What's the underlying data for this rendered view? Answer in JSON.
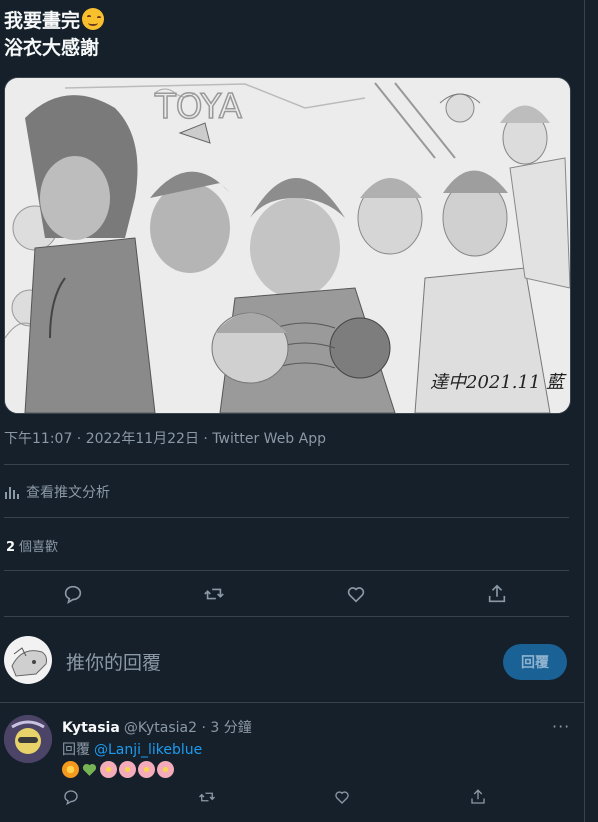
{
  "tweet": {
    "line1": "我要畫完",
    "line2": "浴衣大感謝",
    "emoji_icon": "smiling-face-relaxed-icon",
    "image_signature": "達中2021.11 藍",
    "timestamp": "下午11:07 · 2022年11月22日 · Twitter Web App",
    "analytics_label": "查看推文分析",
    "likes_count": "2",
    "likes_label": "個喜歡"
  },
  "compose": {
    "placeholder": "推你的回覆",
    "reply_button": "回覆"
  },
  "reply": {
    "name": "Kytasia",
    "handle": "@Kytasia2 · 3 分鐘",
    "replying_to_label": "回覆",
    "replying_to_handle": "@Lanji_likeblue",
    "emojis": [
      "blossom-orange",
      "green-heart",
      "cherry-blossom",
      "cherry-blossom",
      "cherry-blossom",
      "cherry-blossom"
    ],
    "more": "···"
  },
  "colors": {
    "background": "#15202b",
    "border": "#38444d",
    "secondary_text": "#8b98a5",
    "link": "#1d9bf0",
    "reply_button_bg": "#1a6196"
  }
}
